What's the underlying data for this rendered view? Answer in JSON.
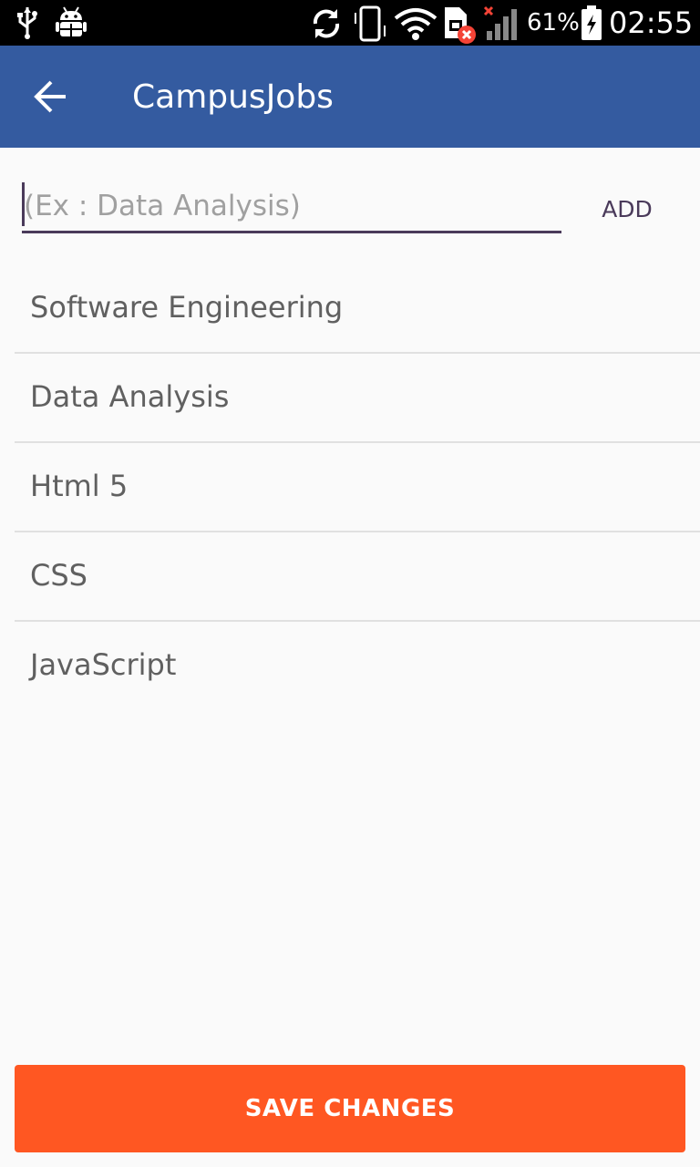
{
  "status_bar": {
    "battery_percent": "61%",
    "time": "02:55",
    "icons": [
      "usb-icon",
      "android-debug-icon",
      "sync-icon",
      "vibrate-icon",
      "wifi-icon",
      "sim-error-icon",
      "signal-icon",
      "battery-charging-icon"
    ],
    "error_color": "#f44336"
  },
  "app_bar": {
    "title": "CampusJobs",
    "color": "#345ba0"
  },
  "add_skill": {
    "placeholder": "(Ex : Data Analysis)",
    "value": "",
    "add_label": "ADD"
  },
  "skills": [
    {
      "label": "Software Engineering"
    },
    {
      "label": "Data Analysis"
    },
    {
      "label": "Html 5"
    },
    {
      "label": "CSS"
    },
    {
      "label": "JavaScript"
    }
  ],
  "save_button": {
    "label": "SAVE CHANGES",
    "color": "#ff5722"
  }
}
